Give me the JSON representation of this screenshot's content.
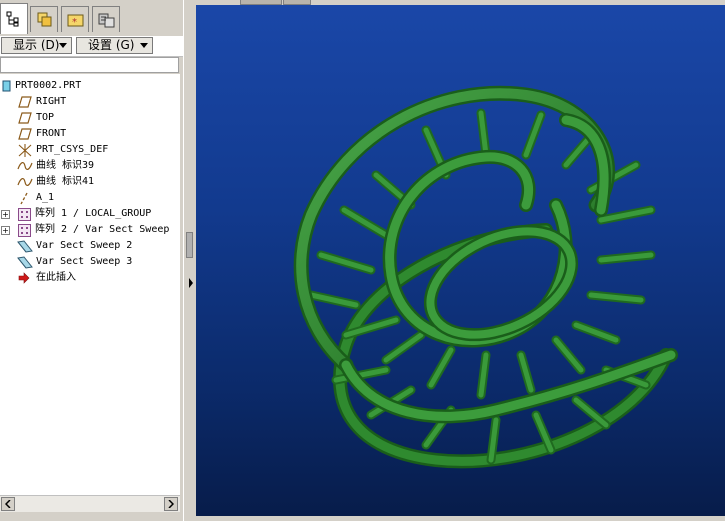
{
  "toolbar": {
    "display_label": "显示 (D)",
    "settings_label": "设置 (G)"
  },
  "tabs": [
    {
      "name": "model-tree-icon"
    },
    {
      "name": "folder-browser-icon"
    },
    {
      "name": "favorites-icon"
    },
    {
      "name": "connections-icon"
    }
  ],
  "tree": {
    "items": [
      {
        "label": "PRT0002.PRT",
        "icon": "part-icon"
      },
      {
        "label": "RIGHT",
        "icon": "datum-plane-icon"
      },
      {
        "label": "TOP",
        "icon": "datum-plane-icon"
      },
      {
        "label": "FRONT",
        "icon": "datum-plane-icon"
      },
      {
        "label": "PRT_CSYS_DEF",
        "icon": "coordinate-system-icon"
      },
      {
        "label": "曲线 标识39",
        "icon": "curve-icon"
      },
      {
        "label": "曲线 标识41",
        "icon": "curve-icon"
      },
      {
        "label": "A_1",
        "icon": "datum-axis-icon"
      },
      {
        "label": "阵列 1 / LOCAL_GROUP",
        "icon": "pattern-icon",
        "expandable": true
      },
      {
        "label": "阵列 2 / Var Sect Sweep",
        "icon": "pattern-icon",
        "expandable": true
      },
      {
        "label": "Var Sect Sweep 2",
        "icon": "sweep-icon"
      },
      {
        "label": "Var Sect Sweep 3",
        "icon": "sweep-icon"
      },
      {
        "label": "在此插入",
        "icon": "insert-here-arrow-icon"
      }
    ]
  },
  "colors": {
    "viewport_top": "#1a47a8",
    "viewport_bottom": "#071c4a",
    "model_green": "#2f8a2f",
    "model_dark": "#1a5e1a"
  }
}
